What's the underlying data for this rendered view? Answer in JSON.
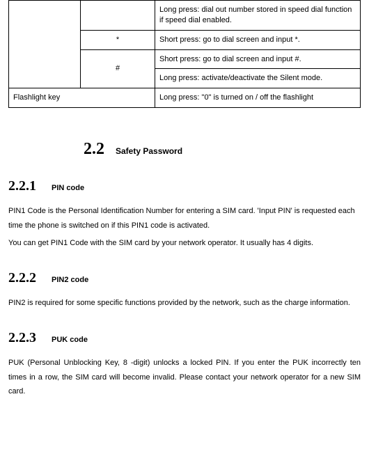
{
  "table": {
    "r1_desc": "Long press: dial out number stored in speed dial function if speed dial enabled.",
    "r2_sym": "*",
    "r2_desc": "Short press: go to dial screen and input *.",
    "r3_sym": "#",
    "r3_desc": "Short press: go to dial screen and input #.",
    "r4_desc": "Long press: activate/deactivate the Silent mode.",
    "r5_key": "Flashlight key",
    "r5_desc": "Long press: \"0\" is turned on / off the flashlight"
  },
  "sec22": {
    "num": "2.2",
    "title": "Safety Password"
  },
  "s221": {
    "num": "2.2.1",
    "title": "PIN code",
    "p1": "PIN1 Code is the Personal Identification Number for entering a SIM card. 'Input PIN' is requested each time the phone is switched on if this PIN1 code is activated.",
    "p2": "You can get PIN1 Code with the SIM card by your network operator. It usually has 4 digits."
  },
  "s222": {
    "num": "2.2.2",
    "title": "PIN2 code",
    "p1": "PIN2 is required for some specific functions provided by the network, such as the charge information."
  },
  "s223": {
    "num": "2.2.3",
    "title": "PUK code",
    "p1": "PUK (Personal Unblocking Key, 8 -digit) unlocks a locked PIN. If you enter the PUK incorrectly ten times in a row, the SIM card will become invalid. Please contact your network operator for a new SIM card."
  }
}
